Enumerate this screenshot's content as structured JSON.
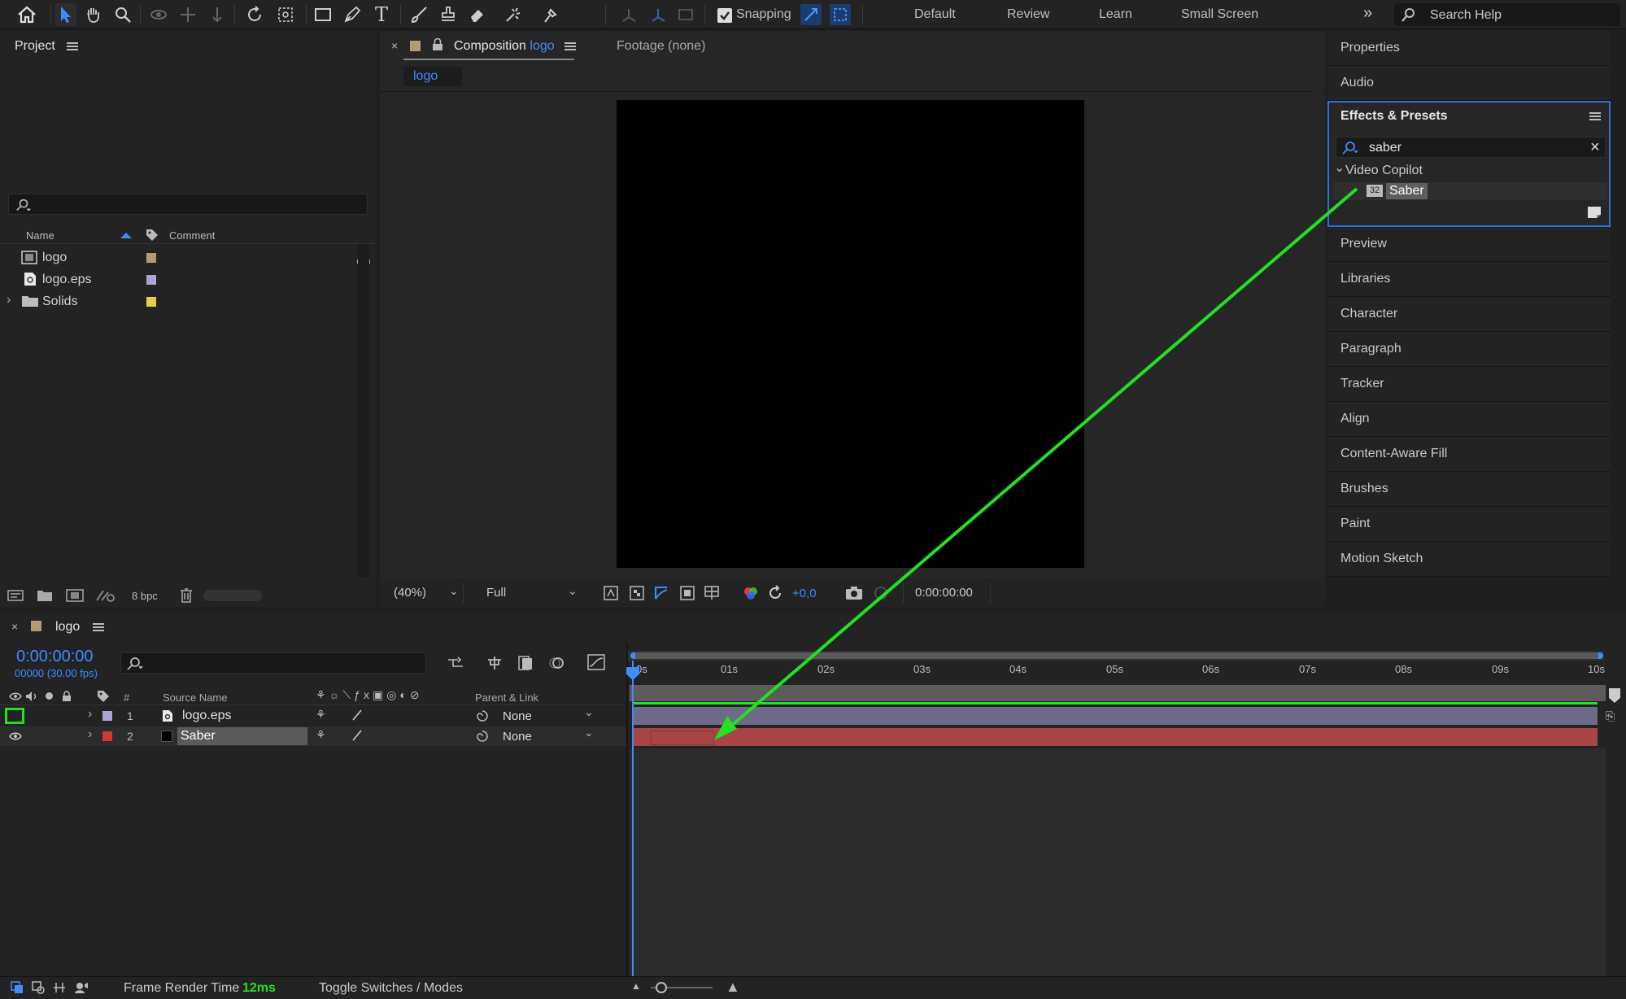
{
  "toolbar": {
    "snapping_label": "Snapping",
    "workspaces": [
      "Default",
      "Review",
      "Learn",
      "Small Screen"
    ],
    "search_placeholder": "Search Help"
  },
  "project": {
    "title": "Project",
    "col_name": "Name",
    "col_comment": "Comment",
    "items": [
      {
        "name": "logo",
        "color": "#b59a77"
      },
      {
        "name": "logo.eps",
        "color": "#a9a5d6"
      },
      {
        "name": "Solids",
        "color": "#e2cf4a"
      }
    ],
    "bpc": "8 bpc"
  },
  "viewer": {
    "comp_tab_prefix": "Composition",
    "comp_tab_name": "logo",
    "footage_tab": "Footage (none)",
    "sub_tab": "logo",
    "zoom": "(40%)",
    "quality": "Full",
    "exposure": "+0,0",
    "timecode": "0:00:00:00"
  },
  "right_panel": {
    "properties": "Properties",
    "audio": "Audio",
    "effects_title": "Effects & Presets",
    "search_value": "saber",
    "category": "Video Copilot",
    "effect": "Saber",
    "effect_badge": "32",
    "items": [
      "Preview",
      "Libraries",
      "Character",
      "Paragraph",
      "Tracker",
      "Align",
      "Content-Aware Fill",
      "Brushes",
      "Paint",
      "Motion Sketch"
    ]
  },
  "timeline": {
    "tab": "logo",
    "timecode": "0:00:00:00",
    "frame_info": "00000 (30.00 fps)",
    "col_num": "#",
    "col_source": "Source Name",
    "col_parent": "Parent & Link",
    "ruler": [
      "0s",
      "01s",
      "02s",
      "03s",
      "04s",
      "05s",
      "06s",
      "07s",
      "08s",
      "09s",
      "10s"
    ],
    "layers": [
      {
        "num": "1",
        "name": "logo.eps",
        "parent": "None",
        "color": "#a9a5d6"
      },
      {
        "num": "2",
        "name": "Saber",
        "parent": "None",
        "color": "#cc3a3a"
      }
    ]
  },
  "status": {
    "frame_render_label": "Frame Render Time",
    "frame_render_value": "12ms",
    "toggle": "Toggle Switches / Modes"
  },
  "annotation_color": "#22e022"
}
